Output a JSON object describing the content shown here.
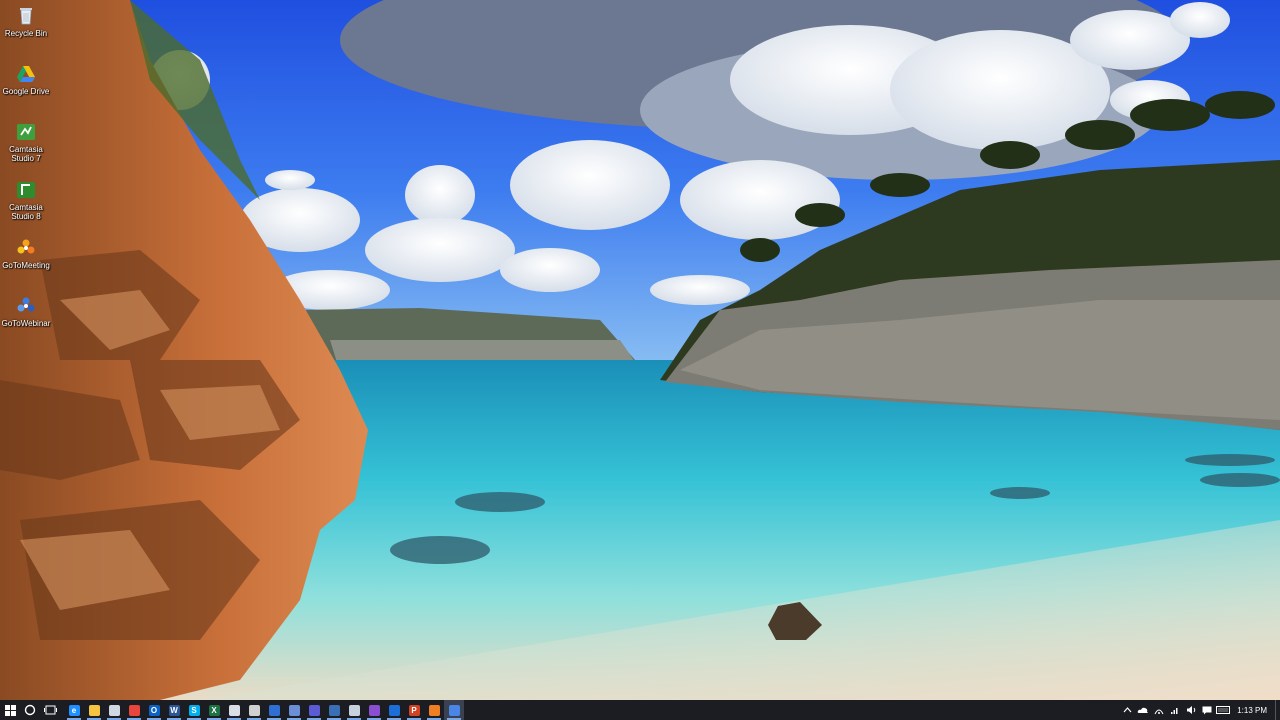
{
  "desktop": {
    "icons": [
      {
        "label": "Recycle Bin",
        "icon": "recycle-bin-icon"
      },
      {
        "label": "Google Drive",
        "icon": "google-drive-icon"
      },
      {
        "label": "Camtasia Studio 7",
        "icon": "camtasia-icon"
      },
      {
        "label": "Camtasia Studio 8",
        "icon": "camtasia-icon"
      },
      {
        "label": "GoToMeeting",
        "icon": "gotomeeting-icon"
      },
      {
        "label": "GoToWebinar",
        "icon": "gotowebinar-icon"
      }
    ]
  },
  "taskbar": {
    "start_icon": "windows-start-icon",
    "search_icon": "cortana-search-icon",
    "task_view_icon": "task-view-icon",
    "pinned": [
      {
        "icon": "edge-icon",
        "color": "#1e90ff",
        "glyph": "e"
      },
      {
        "icon": "file-explorer-icon",
        "color": "#f5c542",
        "glyph": ""
      },
      {
        "icon": "store-icon",
        "color": "#cfd8e3",
        "glyph": ""
      },
      {
        "icon": "chrome-icon",
        "color": "#e8453c",
        "glyph": ""
      },
      {
        "icon": "outlook-icon",
        "color": "#0a64c8",
        "glyph": "O"
      },
      {
        "icon": "word-icon",
        "color": "#2b5797",
        "glyph": "W"
      },
      {
        "icon": "skype-icon",
        "color": "#00aff0",
        "glyph": "S"
      },
      {
        "icon": "excel-icon",
        "color": "#1f7244",
        "glyph": "X"
      },
      {
        "icon": "document-icon",
        "color": "#d8dde6",
        "glyph": ""
      },
      {
        "icon": "calculator-icon",
        "color": "#d0d0d0",
        "glyph": ""
      },
      {
        "icon": "teamviewer-icon",
        "color": "#2f6fd3",
        "glyph": ""
      },
      {
        "icon": "notepad-icon",
        "color": "#6b8fd6",
        "glyph": ""
      },
      {
        "icon": "app-purple-icon",
        "color": "#5b5bd6",
        "glyph": ""
      },
      {
        "icon": "globe-app-icon",
        "color": "#3b6fb5",
        "glyph": ""
      },
      {
        "icon": "snipping-tool-icon",
        "color": "#c8d2dc",
        "glyph": ""
      },
      {
        "icon": "visual-studio-icon",
        "color": "#8a4fd0",
        "glyph": ""
      },
      {
        "icon": "app-blue-icon",
        "color": "#1c6fd8",
        "glyph": ""
      },
      {
        "icon": "powerpoint-icon",
        "color": "#d04423",
        "glyph": "P"
      },
      {
        "icon": "firefox-icon",
        "color": "#f07e22",
        "glyph": ""
      },
      {
        "icon": "gotowebinar-taskbar-icon",
        "color": "#4a86e8",
        "glyph": ""
      }
    ],
    "clock": "1:13 PM",
    "tray_icons": [
      "chevron-up-icon",
      "onedrive-icon",
      "network-icon",
      "wifi-icon",
      "volume-icon",
      "notification-icon",
      "keyboard-icon"
    ]
  }
}
